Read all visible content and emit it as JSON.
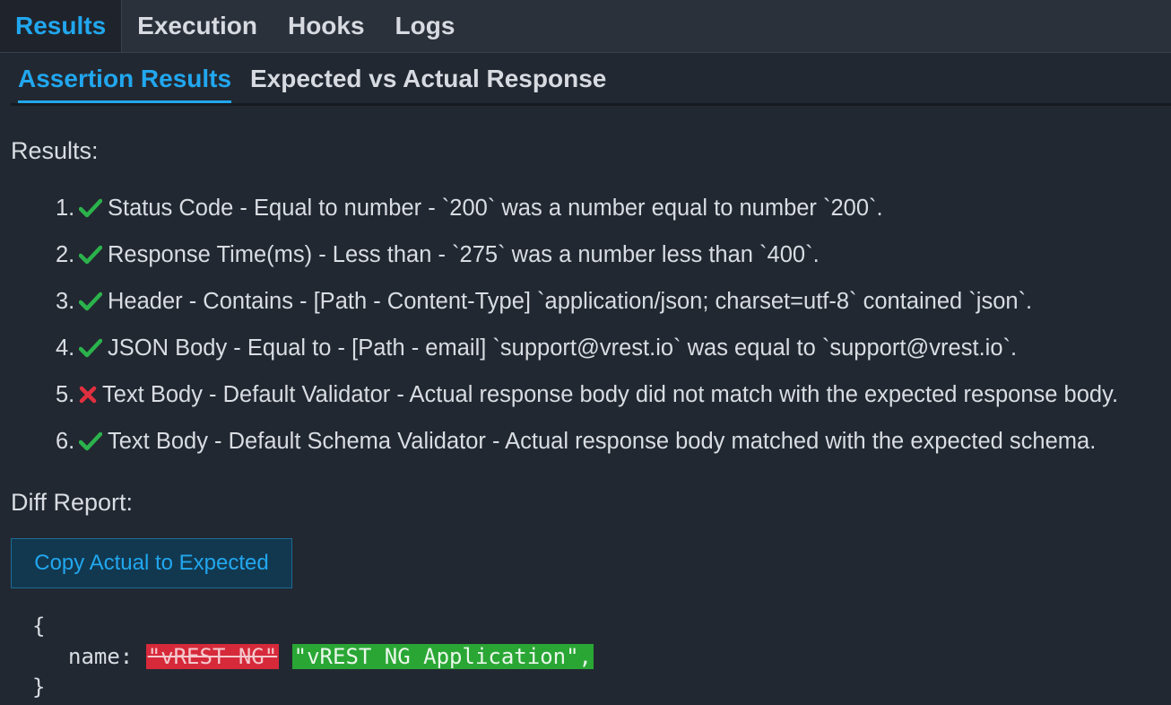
{
  "tabs": {
    "results": "Results",
    "execution": "Execution",
    "hooks": "Hooks",
    "logs": "Logs"
  },
  "subtabs": {
    "assertion_results": "Assertion Results",
    "expected_vs_actual": "Expected vs Actual Response"
  },
  "results_section": {
    "title": "Results:",
    "items": [
      {
        "num": "1.",
        "status": "pass",
        "text": "Status Code - Equal to number - `200` was a number equal to number `200`."
      },
      {
        "num": "2.",
        "status": "pass",
        "text": "Response Time(ms) - Less than - `275` was a number less than `400`."
      },
      {
        "num": "3.",
        "status": "pass",
        "text": "Header - Contains - [Path - Content-Type] `application/json; charset=utf-8` contained `json`."
      },
      {
        "num": "4.",
        "status": "pass",
        "text": "JSON Body - Equal to - [Path - email] `support@vrest.io` was equal to `support@vrest.io`."
      },
      {
        "num": "5.",
        "status": "fail",
        "text": "Text Body - Default Validator - Actual response body did not match with the expected response body."
      },
      {
        "num": "6.",
        "status": "pass",
        "text": "Text Body - Default Schema Validator - Actual response body matched with the expected schema."
      }
    ]
  },
  "diff_section": {
    "title": "Diff Report:",
    "copy_button": "Copy Actual to Expected",
    "open_brace": "{",
    "key": "name:",
    "removed_value": "\"vREST NG\"",
    "added_value": "\"vREST NG Application\",",
    "close_brace": "}"
  },
  "icons": {
    "pass": "check-icon",
    "fail": "cross-icon"
  },
  "colors": {
    "accent": "#21a7ef",
    "pass": "#2bb24c",
    "fail": "#e0303e",
    "removed_bg": "#d6293a",
    "added_bg": "#2aa635"
  }
}
